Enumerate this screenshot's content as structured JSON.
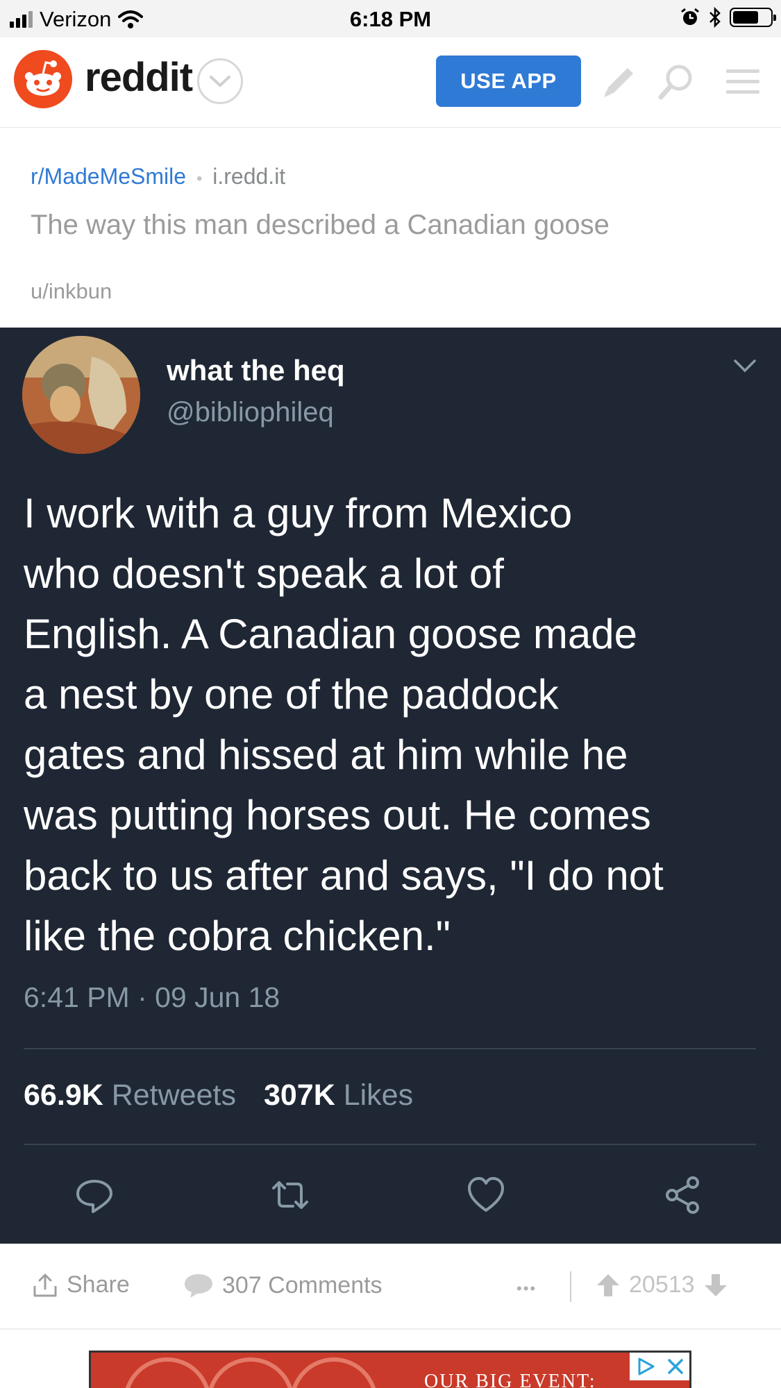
{
  "status_bar": {
    "carrier": "Verizon",
    "time": "6:18 PM"
  },
  "header": {
    "logo_text": "reddit",
    "use_app_label": "USE APP"
  },
  "post": {
    "subreddit": "r/MadeMeSmile",
    "domain": "i.redd.it",
    "separator": "•",
    "title": "The way this man described a Canadian goose",
    "author": "u/inkbun"
  },
  "tweet": {
    "display_name": "what the heq",
    "handle": "@bibliophileq",
    "body_lines": [
      "I work with a guy from Mexico",
      "who doesn't speak a lot of",
      "English. A Canadian goose made",
      "a nest by one of the paddock",
      "gates and hissed at him while he",
      "was putting horses out. He comes",
      "back to us after and says, \"I do not",
      "like the cobra chicken.\""
    ],
    "timestamp": "6:41 PM · 09 Jun 18",
    "retweets_count": "66.9K",
    "retweets_label": "Retweets",
    "likes_count": "307K",
    "likes_label": "Likes"
  },
  "footer": {
    "share_label": "Share",
    "comments_label": "307 Comments",
    "more_label": "•••",
    "score": "20513"
  },
  "ad": {
    "text": "OUR BIG EVENT:"
  },
  "colors": {
    "reddit_orange": "#f04a1f",
    "link_blue": "#2f7ad5",
    "tweet_bg": "#1f2734",
    "tweet_muted": "#8899a6"
  }
}
